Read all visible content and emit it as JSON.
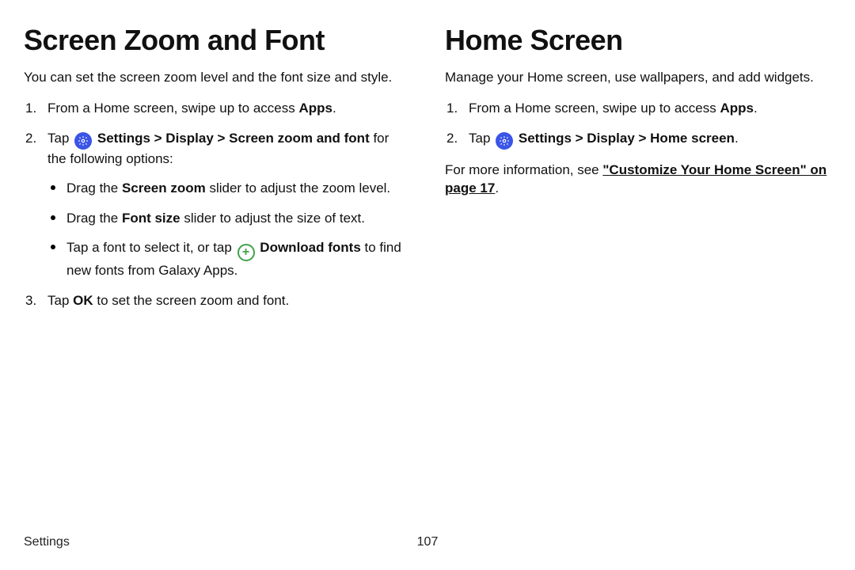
{
  "left": {
    "heading": "Screen Zoom and Font",
    "intro": "You can set the screen zoom level and the font size and style.",
    "step1_pre": "From a Home screen, swipe up to access ",
    "step1_bold": "Apps",
    "step1_post": ".",
    "step2_pre": "Tap ",
    "step2_bold": "Settings > Display > Screen zoom and font",
    "step2_post": " for the following options:",
    "bullet1_pre": "Drag the ",
    "bullet1_bold": "Screen zoom",
    "bullet1_post": " slider to adjust the zoom level.",
    "bullet2_pre": "Drag the ",
    "bullet2_bold": "Font size",
    "bullet2_post": " slider to adjust the size of text.",
    "bullet3_pre": "Tap a font to select it, or tap ",
    "bullet3_bold": "Download fonts",
    "bullet3_post": " to find new fonts from Galaxy Apps.",
    "step3_pre": "Tap ",
    "step3_bold": "OK",
    "step3_post": " to set the screen zoom and font."
  },
  "right": {
    "heading": "Home Screen",
    "intro": "Manage your Home screen, use wallpapers, and add widgets.",
    "step1_pre": "From a Home screen, swipe up to access ",
    "step1_bold": "Apps",
    "step1_post": ".",
    "step2_pre": "Tap ",
    "step2_bold": "Settings > Display > Home screen",
    "step2_post": ".",
    "more_pre": "For more information, see ",
    "more_link": "\"Customize Your Home Screen\" on page 17",
    "more_post": "."
  },
  "footer": {
    "section": "Settings",
    "page": "107"
  }
}
